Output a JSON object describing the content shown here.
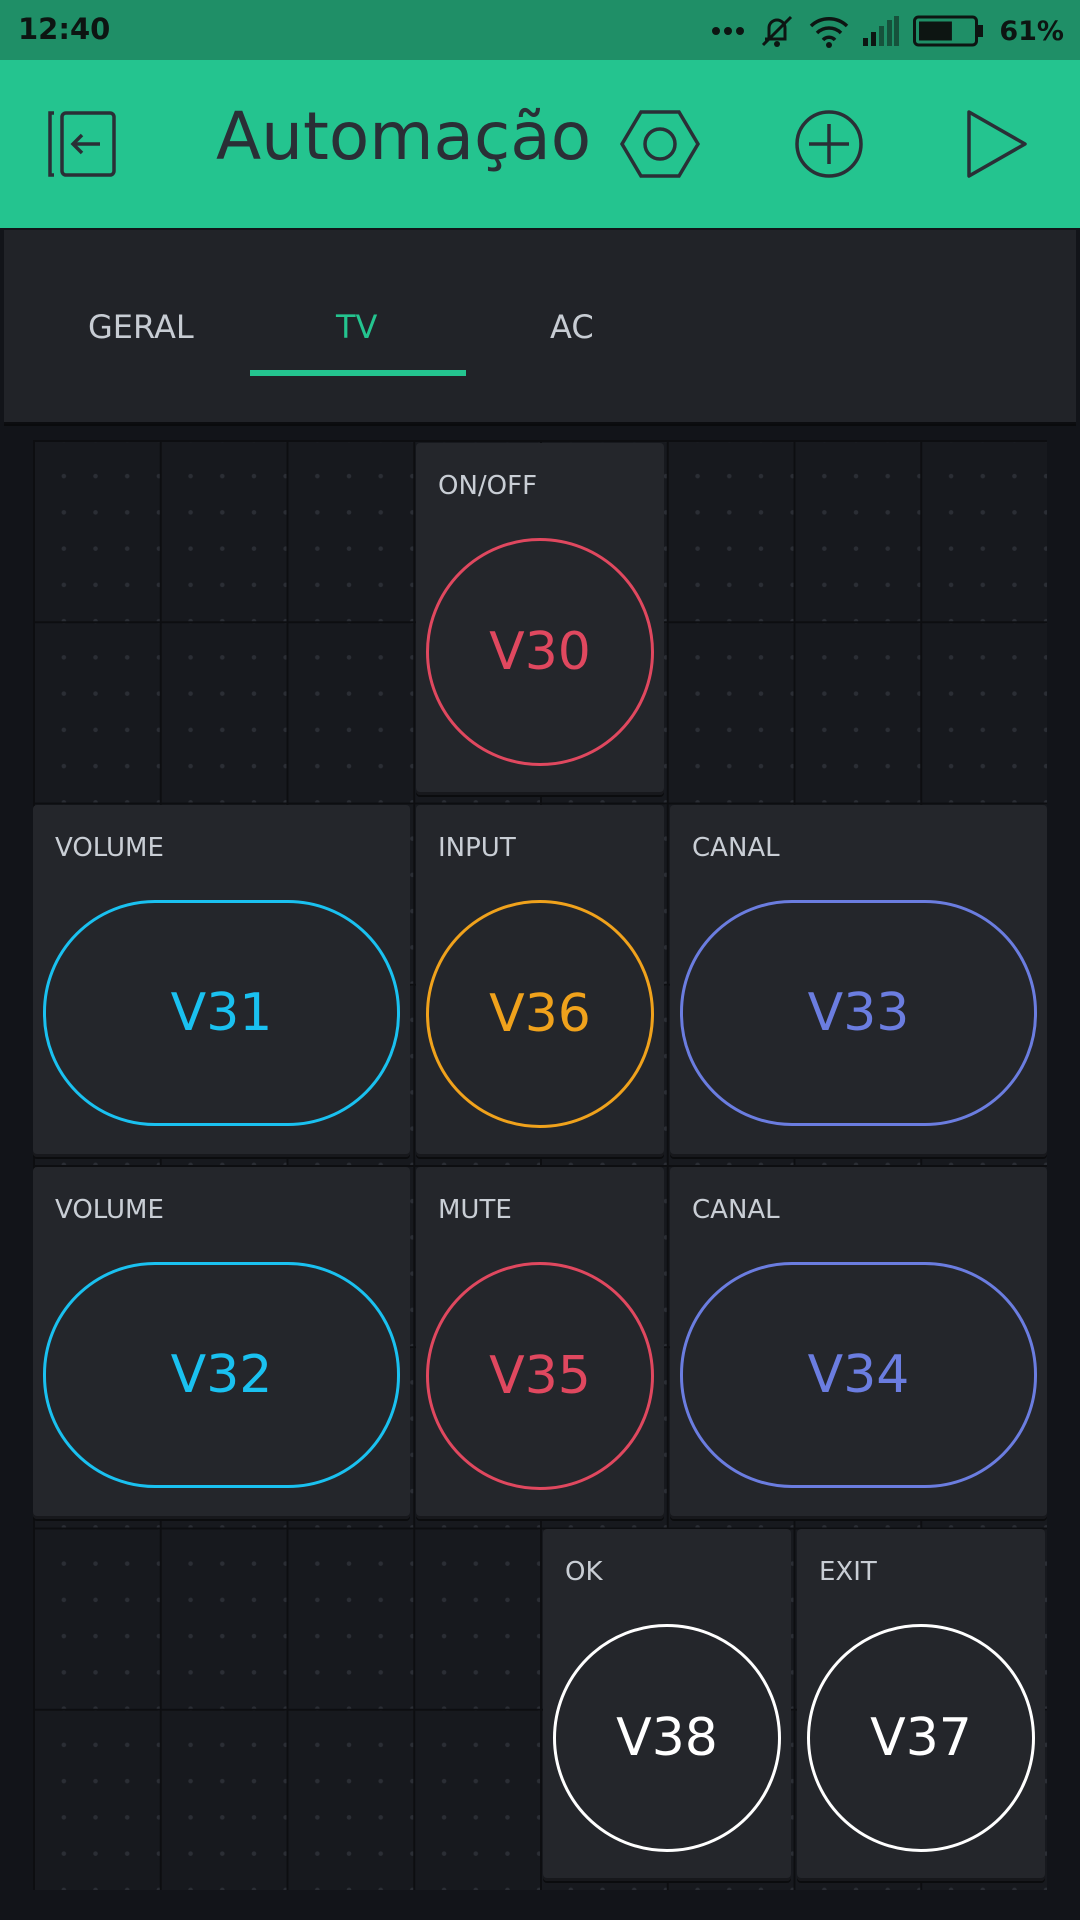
{
  "status_bar": {
    "time": "12:40",
    "battery_percent": "61%",
    "battery_level": 0.61,
    "icons": [
      "more-dots-icon",
      "mute-icon",
      "wifi-icon",
      "signal-icon",
      "battery-icon"
    ]
  },
  "app_bar": {
    "title": "Automação",
    "icons": [
      "exit-project-icon",
      "settings-hex-icon",
      "add-widget-icon",
      "play-icon"
    ]
  },
  "tabs": [
    {
      "label": "GERAL",
      "active": false
    },
    {
      "label": "TV",
      "active": true
    },
    {
      "label": "AC",
      "active": false
    }
  ],
  "widgets": [
    {
      "label": "ON/OFF",
      "pin": "V30",
      "color": "#e0485f"
    },
    {
      "label": "VOLUME",
      "pin": "V31",
      "color": "#1ac1f0"
    },
    {
      "label": "INPUT",
      "pin": "V36",
      "color": "#f0a21c"
    },
    {
      "label": "CANAL",
      "pin": "V33",
      "color": "#6b7de0"
    },
    {
      "label": "VOLUME",
      "pin": "V32",
      "color": "#1ac1f0"
    },
    {
      "label": "MUTE",
      "pin": "V35",
      "color": "#e0485f"
    },
    {
      "label": "CANAL",
      "pin": "V34",
      "color": "#6b7de0"
    },
    {
      "label": "OK",
      "pin": "V38",
      "color": "#ffffff"
    },
    {
      "label": "EXIT",
      "pin": "V37",
      "color": "#ffffff"
    }
  ],
  "colors": {
    "accent": "#24c48f",
    "background": "#121419",
    "widget": "#24262b"
  }
}
